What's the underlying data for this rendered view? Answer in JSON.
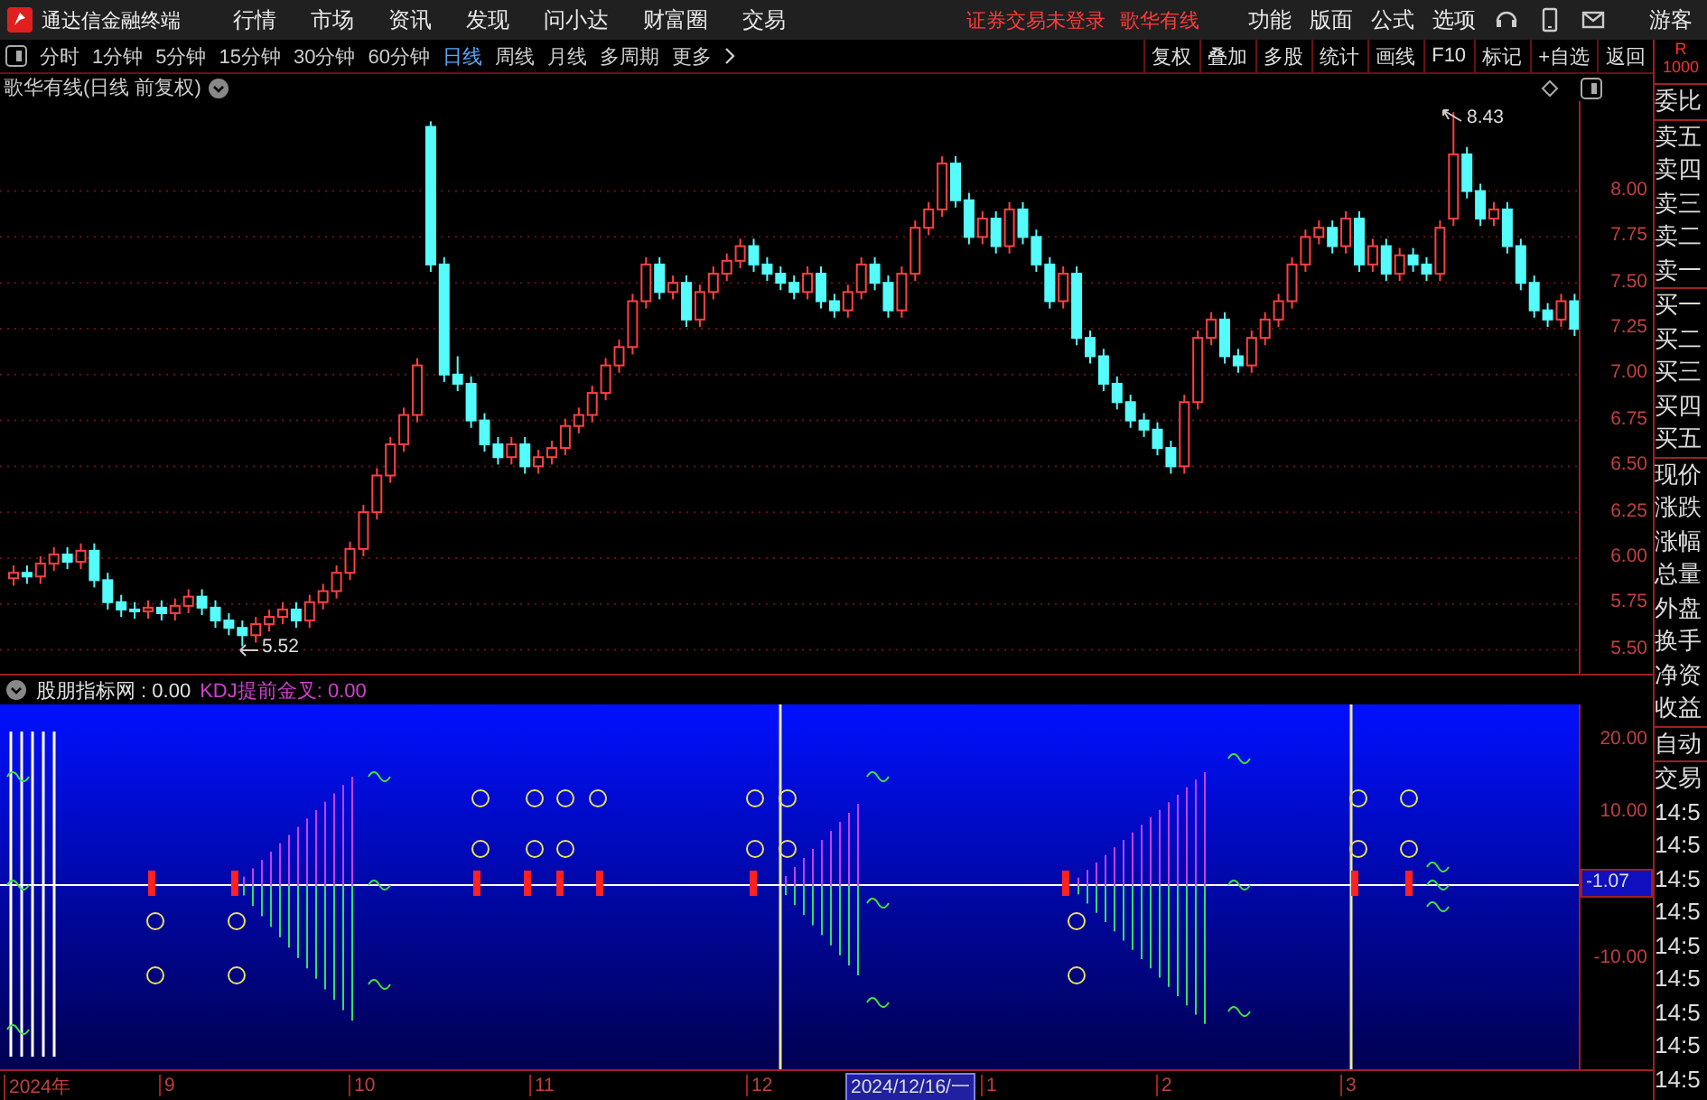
{
  "app": {
    "title": "通达信金融终端"
  },
  "menu": [
    "行情",
    "市场",
    "资讯",
    "发现",
    "问小达",
    "财富圈",
    "交易"
  ],
  "notices": [
    "证券交易未登录",
    "歌华有线"
  ],
  "right_menu": [
    "功能",
    "版面",
    "公式",
    "选项"
  ],
  "user": "游客",
  "periods": [
    {
      "label": "分时",
      "selected": false
    },
    {
      "label": "1分钟",
      "selected": false
    },
    {
      "label": "5分钟",
      "selected": false
    },
    {
      "label": "15分钟",
      "selected": false
    },
    {
      "label": "30分钟",
      "selected": false
    },
    {
      "label": "60分钟",
      "selected": false
    },
    {
      "label": "日线",
      "selected": true
    },
    {
      "label": "周线",
      "selected": false
    },
    {
      "label": "月线",
      "selected": false
    },
    {
      "label": "多周期",
      "selected": false
    },
    {
      "label": "更多",
      "selected": false
    }
  ],
  "tools": [
    "复权",
    "叠加",
    "多股",
    "统计",
    "画线",
    "F10",
    "标记",
    "+自选",
    "返回"
  ],
  "corner": [
    "R",
    "1000"
  ],
  "chart": {
    "title": "歌华有线(日线 前复权)",
    "high_label": "8.43",
    "low_label": "5.52",
    "chart_data": {
      "type": "candlestick",
      "grid": true,
      "ylim": [
        5.37,
        8.49
      ],
      "yticks": [
        {
          "value": 8,
          "label": "8.00"
        },
        {
          "value": 7.75,
          "label": "7.75"
        },
        {
          "value": 7.5,
          "label": "7.50"
        },
        {
          "value": 7.25,
          "label": "7.25"
        },
        {
          "value": 7,
          "label": "7.00"
        },
        {
          "value": 6.75,
          "label": "6.75"
        },
        {
          "value": 6.5,
          "label": "6.50"
        },
        {
          "value": 6.25,
          "label": "6.25"
        },
        {
          "value": 6,
          "label": "6.00"
        },
        {
          "value": 5.75,
          "label": "5.75"
        },
        {
          "value": 5.5,
          "label": "5.50"
        }
      ],
      "ohlc": [
        [
          5.89,
          5.96,
          5.85,
          5.92
        ],
        [
          5.92,
          5.96,
          5.86,
          5.9
        ],
        [
          5.9,
          6.01,
          5.86,
          5.97
        ],
        [
          5.97,
          6.06,
          5.93,
          6.02
        ],
        [
          6.02,
          6.06,
          5.94,
          5.98
        ],
        [
          5.98,
          6.08,
          5.94,
          6.04
        ],
        [
          6.04,
          6.08,
          5.84,
          5.88
        ],
        [
          5.88,
          5.92,
          5.72,
          5.76
        ],
        [
          5.76,
          5.8,
          5.68,
          5.72
        ],
        [
          5.72,
          5.76,
          5.67,
          5.71
        ],
        [
          5.71,
          5.77,
          5.67,
          5.73
        ],
        [
          5.73,
          5.77,
          5.66,
          5.7
        ],
        [
          5.7,
          5.78,
          5.66,
          5.74
        ],
        [
          5.74,
          5.83,
          5.7,
          5.79
        ],
        [
          5.79,
          5.83,
          5.69,
          5.73
        ],
        [
          5.73,
          5.77,
          5.62,
          5.66
        ],
        [
          5.66,
          5.7,
          5.58,
          5.62
        ],
        [
          5.62,
          5.66,
          5.52,
          5.58
        ],
        [
          5.58,
          5.68,
          5.54,
          5.64
        ],
        [
          5.64,
          5.72,
          5.6,
          5.68
        ],
        [
          5.68,
          5.76,
          5.64,
          5.72
        ],
        [
          5.72,
          5.76,
          5.62,
          5.66
        ],
        [
          5.66,
          5.8,
          5.62,
          5.76
        ],
        [
          5.76,
          5.86,
          5.72,
          5.82
        ],
        [
          5.82,
          5.96,
          5.78,
          5.92
        ],
        [
          5.92,
          6.09,
          5.88,
          6.05
        ],
        [
          6.05,
          6.29,
          6.01,
          6.25
        ],
        [
          6.25,
          6.49,
          6.21,
          6.45
        ],
        [
          6.45,
          6.66,
          6.41,
          6.62
        ],
        [
          6.62,
          6.82,
          6.58,
          6.78
        ],
        [
          6.78,
          7.09,
          6.74,
          7.05
        ],
        [
          8.35,
          8.38,
          7.56,
          7.6
        ],
        [
          7.6,
          7.64,
          6.96,
          7.0
        ],
        [
          7.0,
          7.1,
          6.91,
          6.95
        ],
        [
          6.95,
          6.99,
          6.71,
          6.75
        ],
        [
          6.75,
          6.79,
          6.58,
          6.62
        ],
        [
          6.62,
          6.66,
          6.51,
          6.55
        ],
        [
          6.55,
          6.66,
          6.51,
          6.62
        ],
        [
          6.62,
          6.66,
          6.46,
          6.5
        ],
        [
          6.5,
          6.59,
          6.46,
          6.55
        ],
        [
          6.55,
          6.64,
          6.51,
          6.6
        ],
        [
          6.6,
          6.76,
          6.56,
          6.72
        ],
        [
          6.72,
          6.82,
          6.68,
          6.78
        ],
        [
          6.78,
          6.94,
          6.74,
          6.9
        ],
        [
          6.9,
          7.09,
          6.86,
          7.05
        ],
        [
          7.05,
          7.19,
          7.01,
          7.15
        ],
        [
          7.15,
          7.44,
          7.11,
          7.4
        ],
        [
          7.4,
          7.64,
          7.36,
          7.6
        ],
        [
          7.6,
          7.64,
          7.41,
          7.45
        ],
        [
          7.45,
          7.54,
          7.41,
          7.5
        ],
        [
          7.5,
          7.54,
          7.26,
          7.3
        ],
        [
          7.3,
          7.49,
          7.26,
          7.45
        ],
        [
          7.45,
          7.59,
          7.41,
          7.55
        ],
        [
          7.55,
          7.66,
          7.51,
          7.62
        ],
        [
          7.62,
          7.74,
          7.58,
          7.7
        ],
        [
          7.7,
          7.74,
          7.56,
          7.6
        ],
        [
          7.6,
          7.64,
          7.51,
          7.55
        ],
        [
          7.55,
          7.59,
          7.46,
          7.5
        ],
        [
          7.5,
          7.54,
          7.41,
          7.45
        ],
        [
          7.45,
          7.59,
          7.41,
          7.55
        ],
        [
          7.55,
          7.59,
          7.36,
          7.4
        ],
        [
          7.4,
          7.44,
          7.31,
          7.35
        ],
        [
          7.35,
          7.49,
          7.31,
          7.45
        ],
        [
          7.45,
          7.64,
          7.41,
          7.6
        ],
        [
          7.6,
          7.64,
          7.46,
          7.5
        ],
        [
          7.5,
          7.54,
          7.31,
          7.35
        ],
        [
          7.35,
          7.59,
          7.31,
          7.55
        ],
        [
          7.55,
          7.84,
          7.51,
          7.8
        ],
        [
          7.8,
          7.94,
          7.76,
          7.9
        ],
        [
          7.9,
          8.19,
          7.86,
          8.15
        ],
        [
          8.15,
          8.19,
          7.91,
          7.95
        ],
        [
          7.95,
          7.99,
          7.71,
          7.75
        ],
        [
          7.75,
          7.89,
          7.71,
          7.85
        ],
        [
          7.85,
          7.89,
          7.66,
          7.7
        ],
        [
          7.7,
          7.94,
          7.66,
          7.9
        ],
        [
          7.9,
          7.94,
          7.71,
          7.75
        ],
        [
          7.75,
          7.79,
          7.56,
          7.6
        ],
        [
          7.6,
          7.64,
          7.36,
          7.4
        ],
        [
          7.4,
          7.59,
          7.36,
          7.55
        ],
        [
          7.55,
          7.59,
          7.16,
          7.2
        ],
        [
          7.2,
          7.24,
          7.06,
          7.1
        ],
        [
          7.1,
          7.14,
          6.91,
          6.95
        ],
        [
          6.95,
          6.99,
          6.81,
          6.85
        ],
        [
          6.85,
          6.89,
          6.71,
          6.75
        ],
        [
          6.75,
          6.79,
          6.66,
          6.7
        ],
        [
          6.7,
          6.74,
          6.56,
          6.6
        ],
        [
          6.6,
          6.64,
          6.46,
          6.5
        ],
        [
          6.5,
          6.89,
          6.46,
          6.85
        ],
        [
          6.85,
          7.24,
          6.81,
          7.2
        ],
        [
          7.2,
          7.34,
          7.16,
          7.3
        ],
        [
          7.3,
          7.34,
          7.06,
          7.1
        ],
        [
          7.1,
          7.14,
          7.01,
          7.05
        ],
        [
          7.05,
          7.24,
          7.01,
          7.2
        ],
        [
          7.2,
          7.34,
          7.16,
          7.3
        ],
        [
          7.3,
          7.44,
          7.26,
          7.4
        ],
        [
          7.4,
          7.64,
          7.36,
          7.6
        ],
        [
          7.6,
          7.79,
          7.56,
          7.75
        ],
        [
          7.75,
          7.84,
          7.71,
          7.8
        ],
        [
          7.8,
          7.84,
          7.66,
          7.7
        ],
        [
          7.7,
          7.89,
          7.66,
          7.85
        ],
        [
          7.85,
          7.89,
          7.56,
          7.6
        ],
        [
          7.6,
          7.74,
          7.56,
          7.7
        ],
        [
          7.7,
          7.74,
          7.51,
          7.55
        ],
        [
          7.55,
          7.69,
          7.51,
          7.65
        ],
        [
          7.65,
          7.69,
          7.56,
          7.6
        ],
        [
          7.6,
          7.64,
          7.51,
          7.55
        ],
        [
          7.55,
          7.84,
          7.51,
          7.8
        ],
        [
          7.85,
          8.43,
          7.81,
          8.2
        ],
        [
          8.2,
          8.24,
          7.96,
          8.0
        ],
        [
          8.0,
          8.04,
          7.81,
          7.85
        ],
        [
          7.85,
          7.94,
          7.81,
          7.9
        ],
        [
          7.9,
          7.94,
          7.66,
          7.7
        ],
        [
          7.7,
          7.74,
          7.46,
          7.5
        ],
        [
          7.5,
          7.54,
          7.31,
          7.35
        ],
        [
          7.35,
          7.39,
          7.26,
          7.3
        ],
        [
          7.3,
          7.44,
          7.26,
          7.4
        ],
        [
          7.4,
          7.44,
          7.21,
          7.25
        ]
      ]
    }
  },
  "indicator": {
    "lines": [
      {
        "text": "股朋指标网 : 0.00",
        "kind": "value"
      },
      {
        "text": "KDJ提前金叉: 0.00",
        "kind": "signal"
      }
    ],
    "ticks": [
      "20.00",
      "10.00",
      "-10.00"
    ],
    "current": "-1.07"
  },
  "x_axis": [
    {
      "label": "2024年",
      "selected": false
    },
    {
      "label": "9",
      "selected": false
    },
    {
      "label": "10",
      "selected": false
    },
    {
      "label": "11",
      "selected": false
    },
    {
      "label": "12",
      "selected": false
    },
    {
      "label": "2024/12/16/一",
      "selected": true
    },
    {
      "label": "1",
      "selected": false
    },
    {
      "label": "2",
      "selected": false
    },
    {
      "label": "3",
      "selected": false
    }
  ],
  "quote_panel": [
    [
      "委比"
    ],
    [
      "卖五",
      "卖四",
      "卖三",
      "卖二",
      "卖一"
    ],
    [
      "买一",
      "买二",
      "买三",
      "买四",
      "买五"
    ],
    [
      "现价",
      "涨跌",
      "涨幅",
      "总量",
      "外盘",
      "换手",
      "净资",
      "收益"
    ],
    [
      "自动"
    ],
    [
      "交易",
      "14:5",
      "14:5",
      "14:5",
      "14:5",
      "14:5",
      "14:5",
      "14:5",
      "14:5",
      "14:5"
    ]
  ]
}
